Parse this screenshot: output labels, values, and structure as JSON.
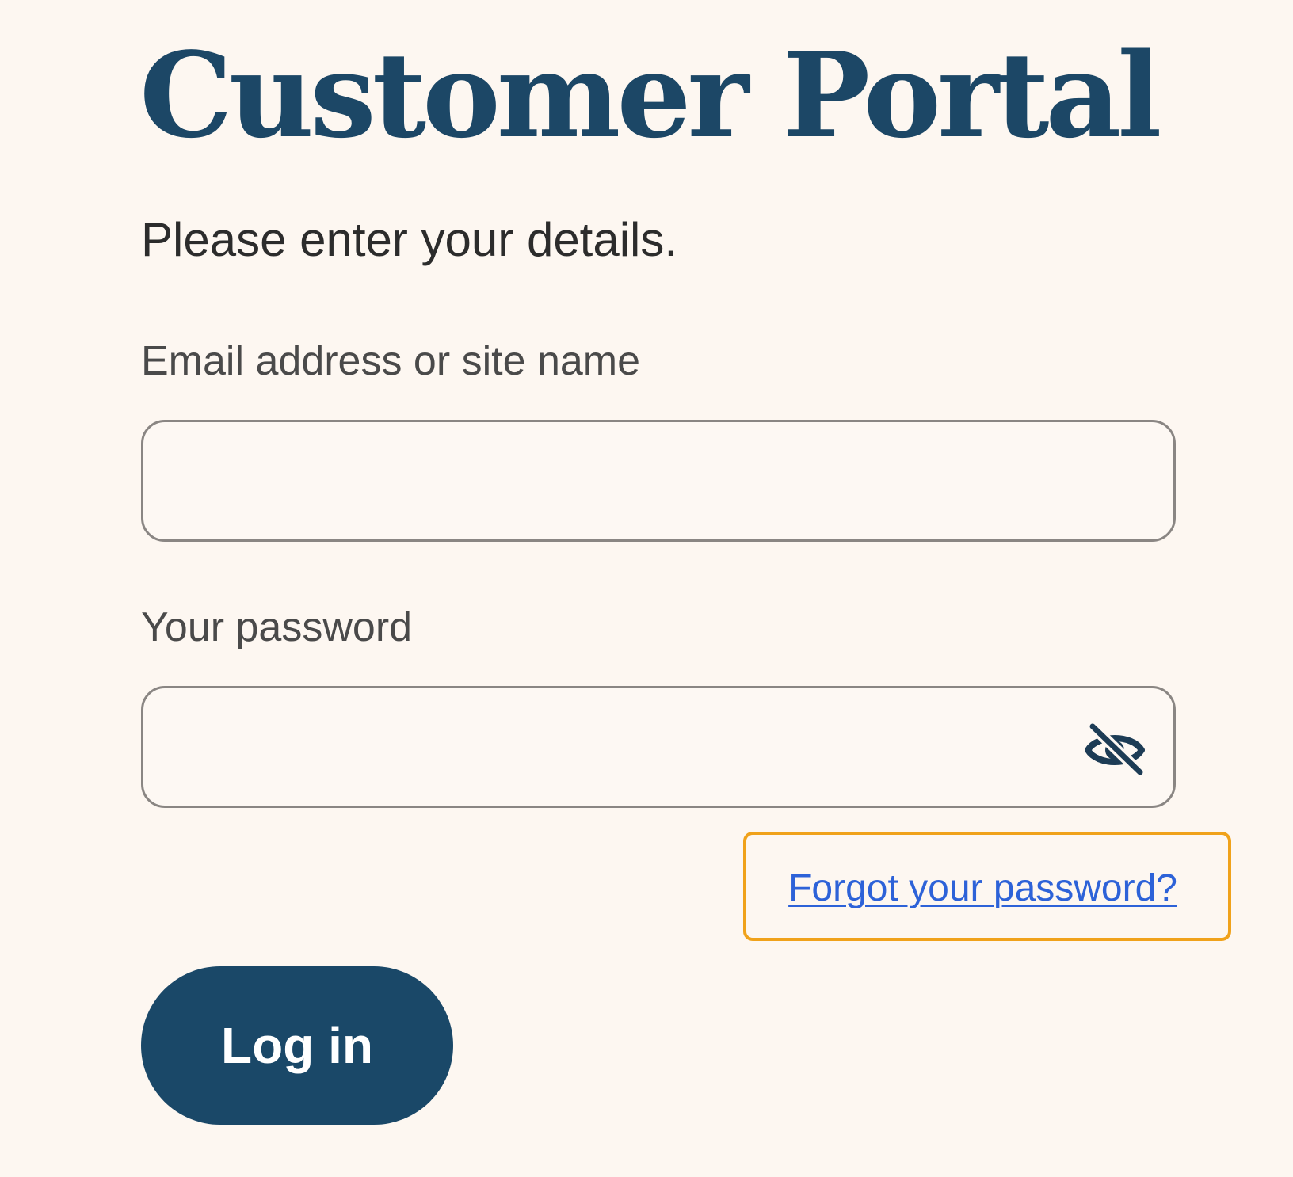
{
  "page": {
    "title": "Customer Portal",
    "subtitle": "Please enter your details."
  },
  "form": {
    "email": {
      "label": "Email address or site name",
      "value": "",
      "placeholder": ""
    },
    "password": {
      "label": "Your password",
      "value": "",
      "placeholder": "",
      "toggle_icon": "eye-slash-icon"
    },
    "forgot_password_link": "Forgot your password?",
    "login_button": "Log in"
  },
  "colors": {
    "background": "#fdf7f1",
    "brand": "#1c4766",
    "button": "#1a4868",
    "link": "#2d62d8",
    "focus_outline": "#f0a21b",
    "input_border": "#8a8683"
  }
}
